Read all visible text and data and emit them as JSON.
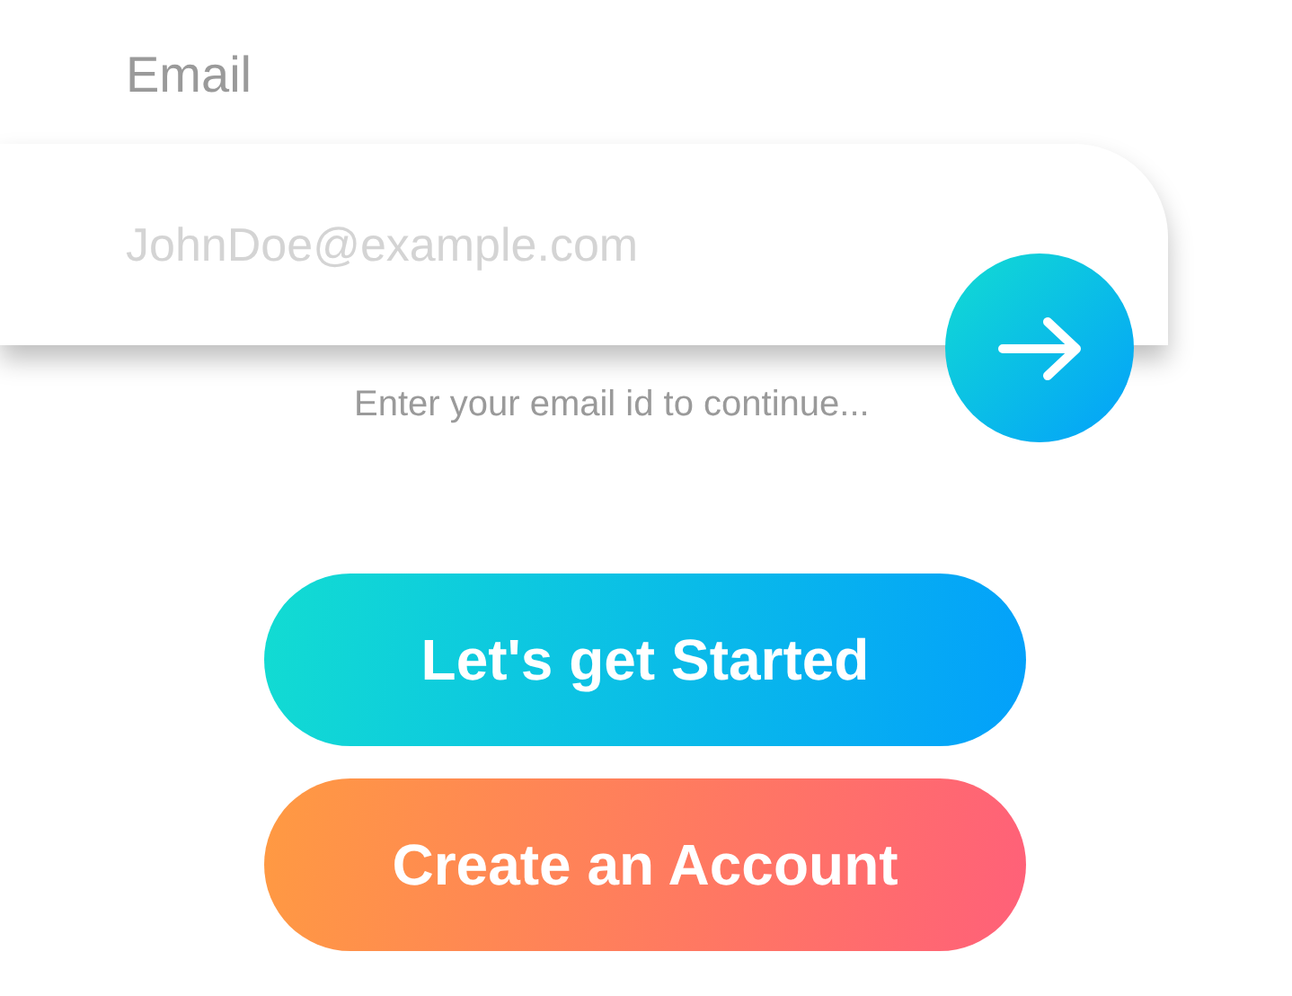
{
  "email_label": "Email",
  "email_field": {
    "placeholder": "JohnDoe@example.com"
  },
  "hint": "Enter your email id to continue...",
  "buttons": [
    {
      "label": "Let's get Started",
      "kind": "primary"
    },
    {
      "label": "Create an Account",
      "kind": "secondary"
    }
  ]
}
